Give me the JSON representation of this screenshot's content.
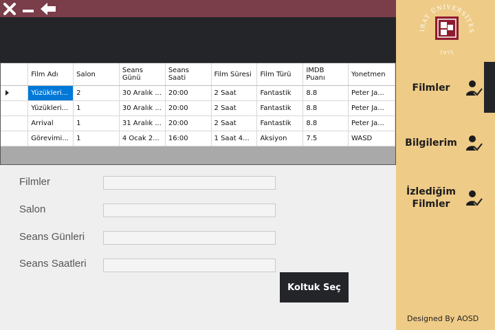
{
  "grid": {
    "columns": [
      {
        "label": "Film Adı",
        "width": 66
      },
      {
        "label": "Salon",
        "width": 67
      },
      {
        "label": "Seans Günü",
        "width": 67
      },
      {
        "label": "Seans Saati",
        "width": 67
      },
      {
        "label": "Film Süresi",
        "width": 67
      },
      {
        "label": "Film Türü",
        "width": 67
      },
      {
        "label": "IMDB Puanı",
        "width": 66
      },
      {
        "label": "Yonetmen",
        "width": 68
      }
    ],
    "rows": [
      [
        "Yüzükleri...",
        "2",
        "30 Aralık ...",
        "20:00",
        "2 Saat",
        "Fantastik",
        "8.8",
        "Peter Ja..."
      ],
      [
        "Yüzükleri...",
        "1",
        "30 Aralık ...",
        "20:00",
        "2 Saat",
        "Fantastik",
        "8.8",
        "Peter Ja..."
      ],
      [
        "Arrival",
        "1",
        "31 Aralık ...",
        "20:00",
        "2 Saat",
        "Fantastik",
        "8.8",
        "Peter Ja..."
      ],
      [
        "Görevimi...",
        "1",
        "4 Ocak 2...",
        "16:00",
        "1 Saat 4...",
        "Aksiyon",
        "7.5",
        "WASD"
      ]
    ]
  },
  "form": {
    "filmler_label": "Filmler",
    "filmler_value": "",
    "salon_label": "Salon",
    "salon_value": "",
    "seans_gunleri_label": "Seans Günleri",
    "seans_gunleri_value": "",
    "seans_saatleri_label": "Seans Saatleri",
    "seans_saatleri_value": ""
  },
  "buttons": {
    "koltuk_sec": "Koltuk Seç"
  },
  "sidebar": {
    "logo_text": "FIRAT ÜNİVERSİTESİ",
    "logo_year": "1975",
    "items": [
      {
        "label": "Filmler",
        "icon": "user-check-icon"
      },
      {
        "label": "Bilgilerim",
        "icon": "user-check-icon"
      },
      {
        "label": "İzlediğim Filmler",
        "icon": "user-check-icon"
      }
    ],
    "footer": "Designed By AOSD"
  },
  "colors": {
    "titlebar": "#7a3d4a",
    "dark": "#232529",
    "sidebar": "#eecb87",
    "selection": "#0078d7",
    "logo_red": "#8e1c2e"
  }
}
